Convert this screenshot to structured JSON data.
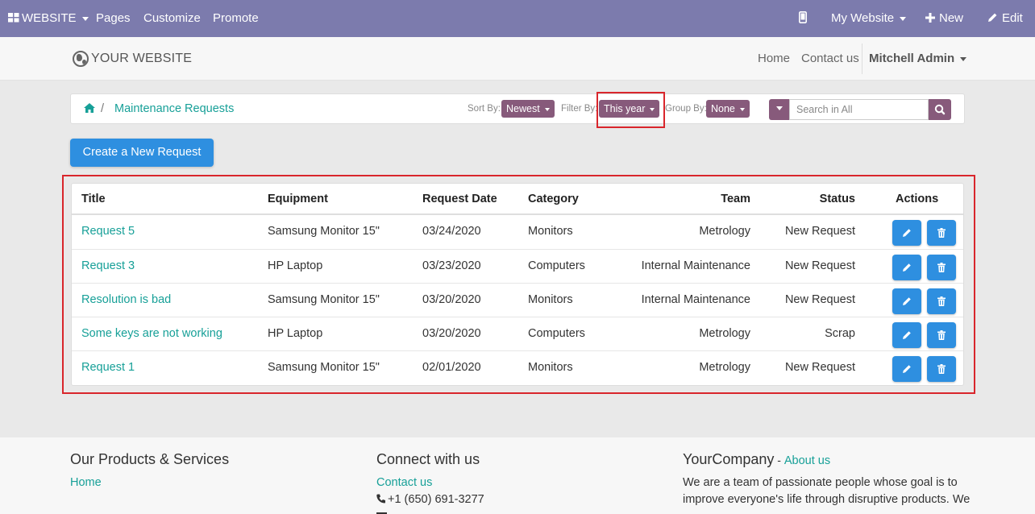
{
  "topbar": {
    "website_label": "WEBSITE",
    "menus": [
      "Pages",
      "Customize",
      "Promote"
    ],
    "my_website": "My Website",
    "new_label": "New",
    "edit_label": "Edit"
  },
  "header": {
    "logo_text": "YOUR WEBSITE",
    "nav": [
      "Home",
      "Contact us"
    ],
    "user": "Mitchell Admin"
  },
  "breadcrumb": {
    "separator": "/",
    "current": "Maintenance Requests"
  },
  "controls": {
    "sort_label": "Sort By:",
    "sort_value": "Newest",
    "filter_label": "Filter By:",
    "filter_value": "This year",
    "group_label": "Group By:",
    "group_value": "None",
    "search_placeholder": "Search in All"
  },
  "create_button": "Create a New Request",
  "table": {
    "columns": [
      "Title",
      "Equipment",
      "Request Date",
      "Category",
      "Team",
      "Status",
      "Actions"
    ],
    "rows": [
      {
        "title": "Request 5",
        "equipment": "Samsung Monitor 15\"",
        "date": "03/24/2020",
        "category": "Monitors",
        "team": "Metrology",
        "status": "New Request"
      },
      {
        "title": "Request 3",
        "equipment": "HP Laptop",
        "date": "03/23/2020",
        "category": "Computers",
        "team": "Internal Maintenance",
        "status": "New Request"
      },
      {
        "title": "Resolution is bad",
        "equipment": "Samsung Monitor 15\"",
        "date": "03/20/2020",
        "category": "Monitors",
        "team": "Internal Maintenance",
        "status": "New Request"
      },
      {
        "title": "Some keys are not working",
        "equipment": "HP Laptop",
        "date": "03/20/2020",
        "category": "Computers",
        "team": "Metrology",
        "status": "Scrap"
      },
      {
        "title": "Request 1",
        "equipment": "Samsung Monitor 15\"",
        "date": "02/01/2020",
        "category": "Monitors",
        "team": "Metrology",
        "status": "New Request"
      }
    ]
  },
  "footer": {
    "col1_title": "Our Products & Services",
    "col1_link": "Home",
    "col2_title": "Connect with us",
    "col2_link": "Contact us",
    "col2_phone": "+1 (650) 691-3277",
    "col3_company": "YourCompany",
    "col3_dash": " - ",
    "col3_link": "About us",
    "col3_text1": "We are a team of passionate people whose goal is to",
    "col3_text2": "improve everyone's life through disruptive products. We"
  },
  "colors": {
    "topbar": "#7c7bad",
    "accent_purple": "#875a7b",
    "link_teal": "#17a098",
    "button_blue": "#2e8fe0",
    "highlight_red": "#d9262c"
  },
  "icons": [
    "apps-grid-icon",
    "mobile-icon",
    "plus-icon",
    "pencil-icon",
    "home-icon",
    "search-icon",
    "trash-icon",
    "phone-icon",
    "envelope-icon"
  ]
}
